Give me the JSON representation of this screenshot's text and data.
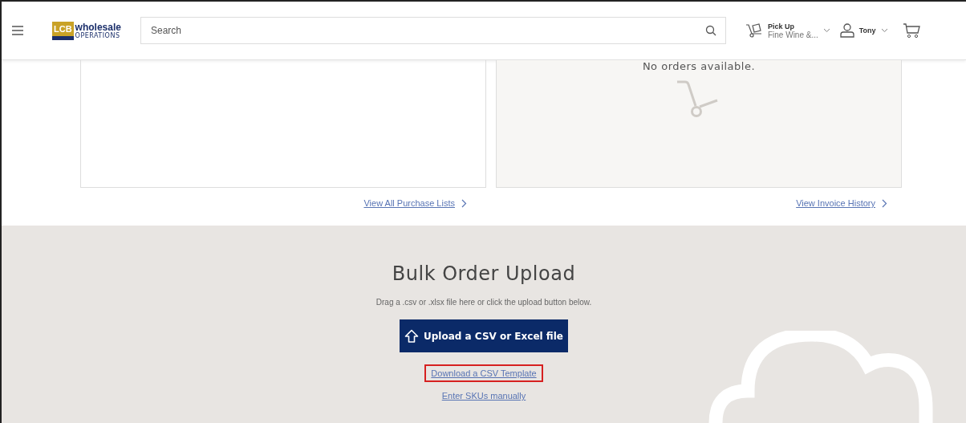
{
  "header": {
    "logo": {
      "badge": "LCB",
      "name": "wholesale",
      "subtitle": "OPERATIONS"
    },
    "search": {
      "placeholder": "Search"
    },
    "pickup": {
      "label": "Pick Up",
      "store": "Fine Wine &..."
    },
    "user": {
      "name": "Tony"
    }
  },
  "cards": [
    {
      "kind": "list",
      "link": "View All Purchase Lists"
    },
    {
      "kind": "orders",
      "message": "No orders available.",
      "link": "View Invoice History"
    }
  ],
  "bulk_upload": {
    "title": "Bulk Order Upload",
    "hint": "Drag a .csv or .xlsx file here or click the upload button below.",
    "button": "Upload a CSV or Excel file",
    "links": [
      {
        "label": "Download a CSV Template",
        "highlighted": true
      },
      {
        "label": "Enter SKUs manually",
        "highlighted": false
      }
    ]
  }
}
